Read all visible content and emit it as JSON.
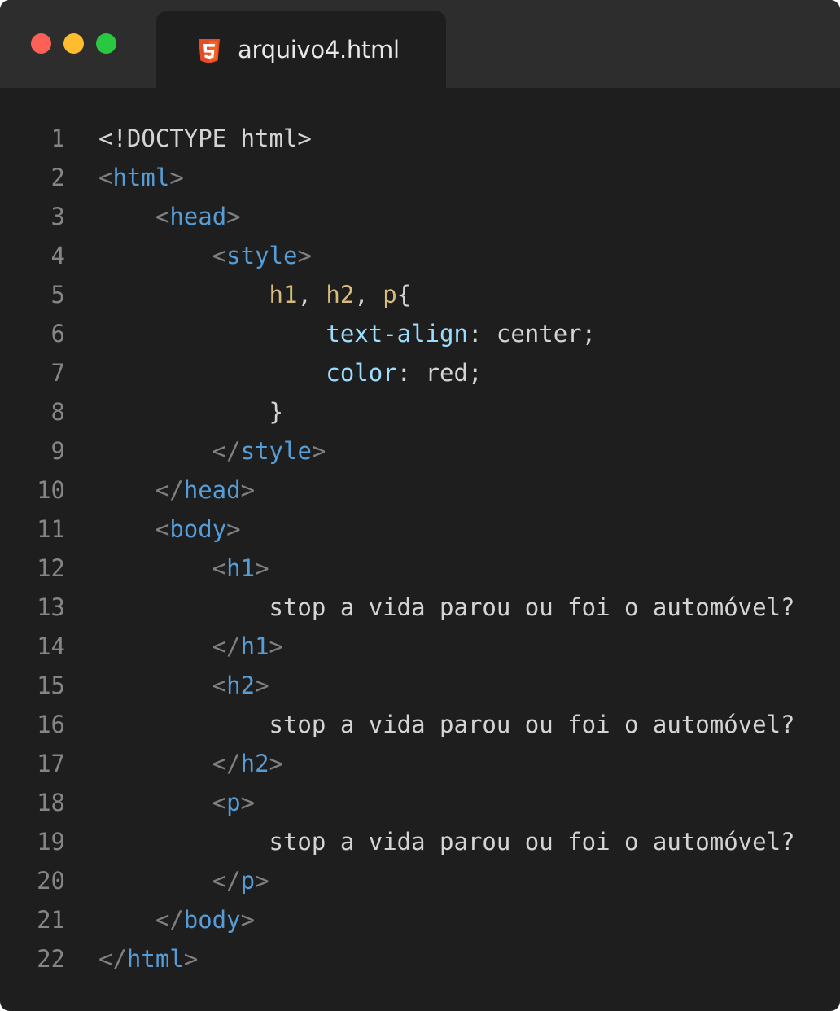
{
  "window": {
    "tab_title": "arquivo4.html",
    "tab_icon": "html5-icon",
    "traffic_lights": {
      "close": "#fe5f57",
      "minimize": "#febc2e",
      "zoom": "#28c840"
    }
  },
  "colors": {
    "background": "#1e1e1e",
    "titlebar": "#2d2d2d",
    "line_number": "#858585",
    "punctuation": "#808080",
    "tag": "#569cd6",
    "selector": "#d7ba7d",
    "property": "#9cdcfe",
    "text": "#d4d4d4"
  },
  "code": {
    "lines": [
      {
        "n": "1",
        "indent": "",
        "tokens": [
          {
            "t": "<!DOCTYPE html>",
            "c": "plain"
          }
        ]
      },
      {
        "n": "2",
        "indent": "",
        "tokens": [
          {
            "t": "<",
            "c": "punc"
          },
          {
            "t": "html",
            "c": "tag"
          },
          {
            "t": ">",
            "c": "punc"
          }
        ]
      },
      {
        "n": "3",
        "indent": "    ",
        "tokens": [
          {
            "t": "<",
            "c": "punc"
          },
          {
            "t": "head",
            "c": "tag"
          },
          {
            "t": ">",
            "c": "punc"
          }
        ]
      },
      {
        "n": "4",
        "indent": "        ",
        "tokens": [
          {
            "t": "<",
            "c": "punc"
          },
          {
            "t": "style",
            "c": "tag"
          },
          {
            "t": ">",
            "c": "punc"
          }
        ]
      },
      {
        "n": "5",
        "indent": "            ",
        "tokens": [
          {
            "t": "h1",
            "c": "sel"
          },
          {
            "t": ", ",
            "c": "plain"
          },
          {
            "t": "h2",
            "c": "sel"
          },
          {
            "t": ", ",
            "c": "plain"
          },
          {
            "t": "p",
            "c": "sel"
          },
          {
            "t": "{",
            "c": "plain"
          }
        ]
      },
      {
        "n": "6",
        "indent": "                ",
        "tokens": [
          {
            "t": "text-align",
            "c": "prop"
          },
          {
            "t": ": center;",
            "c": "plain"
          }
        ]
      },
      {
        "n": "7",
        "indent": "                ",
        "tokens": [
          {
            "t": "color",
            "c": "prop"
          },
          {
            "t": ": red;",
            "c": "plain"
          }
        ]
      },
      {
        "n": "8",
        "indent": "            ",
        "tokens": [
          {
            "t": "}",
            "c": "plain"
          }
        ]
      },
      {
        "n": "9",
        "indent": "        ",
        "tokens": [
          {
            "t": "</",
            "c": "punc"
          },
          {
            "t": "style",
            "c": "tag"
          },
          {
            "t": ">",
            "c": "punc"
          }
        ]
      },
      {
        "n": "10",
        "indent": "    ",
        "tokens": [
          {
            "t": "</",
            "c": "punc"
          },
          {
            "t": "head",
            "c": "tag"
          },
          {
            "t": ">",
            "c": "punc"
          }
        ]
      },
      {
        "n": "11",
        "indent": "    ",
        "tokens": [
          {
            "t": "<",
            "c": "punc"
          },
          {
            "t": "body",
            "c": "tag"
          },
          {
            "t": ">",
            "c": "punc"
          }
        ]
      },
      {
        "n": "12",
        "indent": "        ",
        "tokens": [
          {
            "t": "<",
            "c": "punc"
          },
          {
            "t": "h1",
            "c": "tag"
          },
          {
            "t": ">",
            "c": "punc"
          }
        ]
      },
      {
        "n": "13",
        "indent": "            ",
        "tokens": [
          {
            "t": "stop a vida parou ou foi o automóvel?",
            "c": "plain"
          }
        ]
      },
      {
        "n": "14",
        "indent": "        ",
        "tokens": [
          {
            "t": "</",
            "c": "punc"
          },
          {
            "t": "h1",
            "c": "tag"
          },
          {
            "t": ">",
            "c": "punc"
          }
        ]
      },
      {
        "n": "15",
        "indent": "        ",
        "tokens": [
          {
            "t": "<",
            "c": "punc"
          },
          {
            "t": "h2",
            "c": "tag"
          },
          {
            "t": ">",
            "c": "punc"
          }
        ]
      },
      {
        "n": "16",
        "indent": "            ",
        "tokens": [
          {
            "t": "stop a vida parou ou foi o automóvel?",
            "c": "plain"
          }
        ]
      },
      {
        "n": "17",
        "indent": "        ",
        "tokens": [
          {
            "t": "</",
            "c": "punc"
          },
          {
            "t": "h2",
            "c": "tag"
          },
          {
            "t": ">",
            "c": "punc"
          }
        ]
      },
      {
        "n": "18",
        "indent": "        ",
        "tokens": [
          {
            "t": "<",
            "c": "punc"
          },
          {
            "t": "p",
            "c": "tag"
          },
          {
            "t": ">",
            "c": "punc"
          }
        ]
      },
      {
        "n": "19",
        "indent": "            ",
        "tokens": [
          {
            "t": "stop a vida parou ou foi o automóvel?",
            "c": "plain"
          }
        ]
      },
      {
        "n": "20",
        "indent": "        ",
        "tokens": [
          {
            "t": "</",
            "c": "punc"
          },
          {
            "t": "p",
            "c": "tag"
          },
          {
            "t": ">",
            "c": "punc"
          }
        ]
      },
      {
        "n": "21",
        "indent": "    ",
        "tokens": [
          {
            "t": "</",
            "c": "punc"
          },
          {
            "t": "body",
            "c": "tag"
          },
          {
            "t": ">",
            "c": "punc"
          }
        ]
      },
      {
        "n": "22",
        "indent": "",
        "tokens": [
          {
            "t": "</",
            "c": "punc"
          },
          {
            "t": "html",
            "c": "tag"
          },
          {
            "t": ">",
            "c": "punc"
          }
        ]
      }
    ]
  }
}
